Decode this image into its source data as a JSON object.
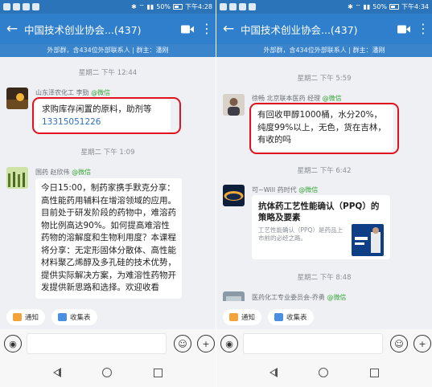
{
  "left": {
    "status": {
      "battery": "50%",
      "time": "下午4:28"
    },
    "header": {
      "back_icon": "arrow-left-icon",
      "title": "中国技术创业协会...(437)",
      "more_icon": "more-vert-icon"
    },
    "subtitle": "外部群，含434位外部联系人 | 群主：潘刚",
    "messages": [
      {
        "timestamp": "星期二 下午 12:44",
        "sender": "山东泽农化工 李勁",
        "wechat_tag": "@微信",
        "text": "求购库存闲置的原料，助剂等",
        "phone": "13315051226"
      },
      {
        "timestamp": "星期二 下午 1:09",
        "sender": "国药 赵欣伟",
        "wechat_tag": "@微信",
        "text": "今日15:00，制药家携手默克分享：高性能药用辅料在增溶领域的应用。目前处于研发阶段的药物中，难溶药物比例高达90%。如何提高难溶性药物的溶解度和生物利用度？本课程将分享：无定形固体分散体、高性能材料聚乙烯醇及多孔硅的技术优势，提供实际解决方案，为难溶性药物开发提供新思路和选择。欢迎收看"
      }
    ],
    "quick": [
      {
        "label": "通知",
        "icon": "megaphone-icon"
      },
      {
        "label": "收集表",
        "icon": "form-icon"
      }
    ]
  },
  "right": {
    "status": {
      "battery": "50%",
      "time": "下午4:34"
    },
    "header": {
      "back_icon": "arrow-left-icon",
      "title": "中国技术创业协会...(437)",
      "more_icon": "more-vert-icon"
    },
    "subtitle": "外部群，含434位外部联系人 | 群主：潘刚",
    "messages": [
      {
        "timestamp": "星期二 下午 5:59",
        "sender": "徐畅 北京联本医药 经理",
        "wechat_tag": "@微信",
        "text": "有回收甲醇1000桶，水分20%，纯度99%以上，无色，货在吉林，有收的吗"
      },
      {
        "timestamp": "星期二 下午 6:42",
        "sender": "可~Will  药时代",
        "wechat_tag": "@微信",
        "card_title": "抗体药工艺性能确认（PPQ）的策略及要素",
        "card_desc": "工艺性能确认（PPQ）是药品上市前的必经之路。",
        "thumb_text": "PPQ"
      },
      {
        "timestamp": "星期二 下午 8:48",
        "sender": "医药化工专业委员会-乔勇",
        "wechat_tag": "@微信"
      }
    ],
    "quick": [
      {
        "label": "通知",
        "icon": "megaphone-icon"
      },
      {
        "label": "收集表",
        "icon": "form-icon"
      }
    ]
  },
  "colors": {
    "title_bar": "#2f7fcc",
    "status_bar": "#2b74ba",
    "highlight": "#e0141e",
    "wechat_green": "#39a539",
    "link": "#2f6fbf"
  }
}
